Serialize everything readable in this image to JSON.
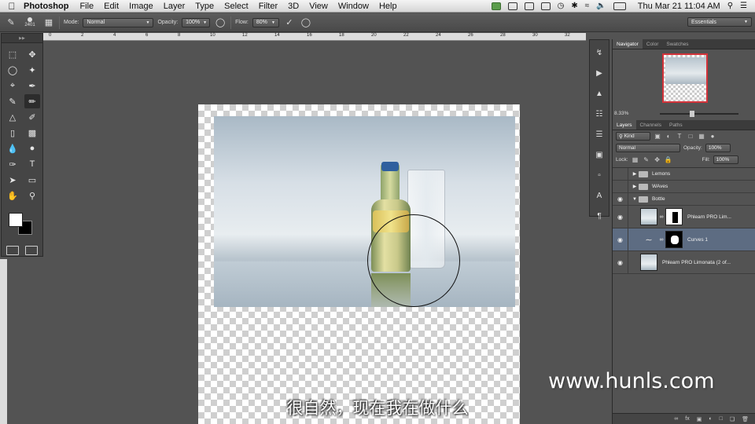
{
  "menubar": {
    "app_name": "Photoshop",
    "menus": [
      "File",
      "Edit",
      "Image",
      "Layer",
      "Type",
      "Select",
      "Filter",
      "3D",
      "View",
      "Window",
      "Help"
    ],
    "clock": "Thu Mar 21  11:04 AM"
  },
  "options": {
    "brush_size": "2401",
    "mode_label": "Mode:",
    "mode_value": "Normal",
    "opacity_label": "Opacity:",
    "opacity_value": "100%",
    "flow_label": "Flow:",
    "flow_value": "80%",
    "workspace": "Essentials"
  },
  "ruler": {
    "ticks": [
      "0",
      "2",
      "4",
      "6",
      "8",
      "10",
      "12",
      "14",
      "16",
      "18",
      "20",
      "22",
      "24",
      "26",
      "28",
      "30",
      "32"
    ]
  },
  "navigator": {
    "tabs": [
      "Navigator",
      "Color",
      "Swatches"
    ],
    "zoom": "8.33%"
  },
  "layers": {
    "tabs": [
      "Layers",
      "Channels",
      "Paths"
    ],
    "kind_label": "Kind",
    "blend_mode": "Normal",
    "opacity_label": "Opacity:",
    "opacity_value": "100%",
    "lock_label": "Lock:",
    "fill_label": "Fill:",
    "fill_value": "100%",
    "items": [
      {
        "name": "Lemons",
        "type": "group",
        "expanded": false,
        "visible": false
      },
      {
        "name": "WAves",
        "type": "group",
        "expanded": false,
        "visible": false
      },
      {
        "name": "Bottle",
        "type": "group",
        "expanded": true,
        "visible": true
      },
      {
        "name": "Phlearn PRO Lim...",
        "type": "masked-layer",
        "visible": true
      },
      {
        "name": "Curves 1",
        "type": "adjustment",
        "visible": true,
        "selected": true
      },
      {
        "name": "Phlearn PRO Limonata (2 of...",
        "type": "layer",
        "visible": true
      }
    ]
  },
  "subtitle": "很自然，现在我在做什么",
  "watermark": "www.hunls.com"
}
